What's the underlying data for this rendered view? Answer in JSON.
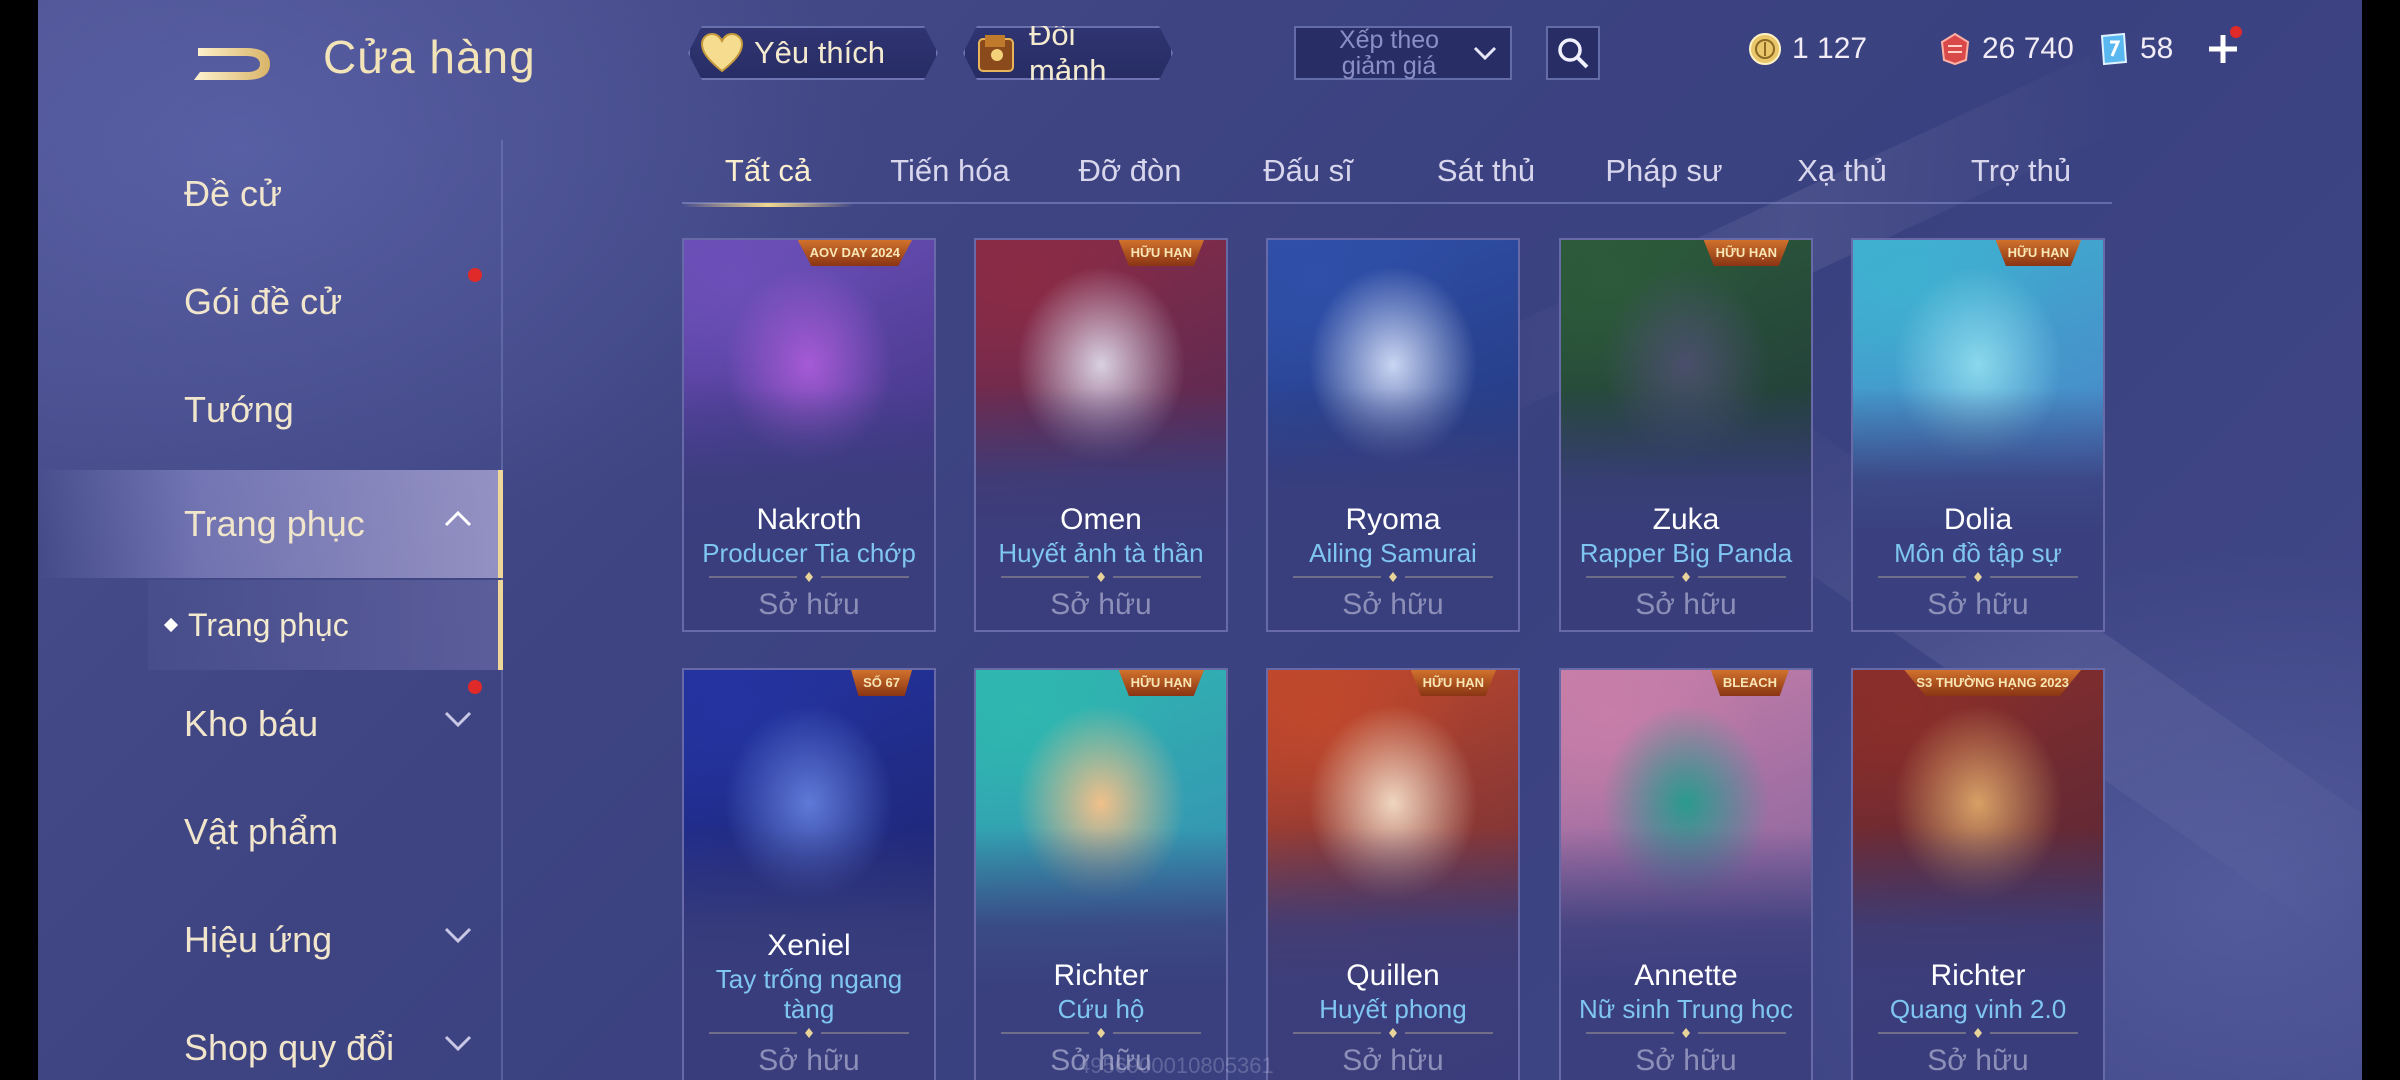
{
  "header": {
    "title": "Cửa hàng",
    "favorites_label": "Yêu thích",
    "exchange_label": "Đổi mảnh",
    "sort_label": "Xếp theo giảm giá",
    "currencies": [
      {
        "icon": "gold-coin-icon",
        "value": "1 127"
      },
      {
        "icon": "red-voucher-icon",
        "value": "26 740"
      },
      {
        "icon": "blue-coupon-icon",
        "value": "58"
      }
    ]
  },
  "sidebar": {
    "items": [
      {
        "label": "Đề cử"
      },
      {
        "label": "Gói đề cử",
        "badge": true
      },
      {
        "label": "Tướng"
      },
      {
        "label": "Trang phục",
        "expanded": true
      },
      {
        "label": "Kho báu",
        "badge": true,
        "collapsed": true
      },
      {
        "label": "Vật phẩm"
      },
      {
        "label": "Hiệu ứng",
        "collapsed": true
      },
      {
        "label": "Shop quy đổi",
        "collapsed": true
      }
    ],
    "sub_item": "Trang phục"
  },
  "tabs": [
    "Tất cả",
    "Tiến hóa",
    "Đỡ đòn",
    "Đấu sĩ",
    "Sát thủ",
    "Pháp sư",
    "Xạ thủ",
    "Trợ thủ"
  ],
  "active_tab": "Tất cả",
  "cards": [
    {
      "hero": "Nakroth",
      "skin": "Producer Tia chớp",
      "status": "Sở hữu",
      "tag": "AOV DAY 2024",
      "colors": [
        "#6c4fb8",
        "#a65ad6",
        "#2d2a6e"
      ]
    },
    {
      "hero": "Omen",
      "skin": "Huyết ảnh tà thần",
      "status": "Sở hữu",
      "tag": "HỮU HẠN",
      "colors": [
        "#8a2b46",
        "#d9d0e2",
        "#3b2a5c"
      ]
    },
    {
      "hero": "Ryoma",
      "skin": "Ailing Samurai",
      "status": "Sở hữu",
      "tag": "",
      "colors": [
        "#2f4fa8",
        "#c9d5f2",
        "#20306e"
      ]
    },
    {
      "hero": "Zuka",
      "skin": "Rapper Big Panda",
      "status": "Sở hữu",
      "tag": "HỮU HẠN",
      "colors": [
        "#2c5a3a",
        "#4a4f6c",
        "#1c2b3a"
      ]
    },
    {
      "hero": "Dolia",
      "skin": "Môn đồ tập sự",
      "status": "Sở hữu",
      "tag": "HỮU HẠN",
      "colors": [
        "#3fb0d0",
        "#8ad8ec",
        "#4e6fc4"
      ]
    },
    {
      "hero": "Xeniel",
      "skin": "Tay trống ngang tàng",
      "status": "Sở hữu",
      "tag": "SỐ 67",
      "colors": [
        "#2433a0",
        "#5f7ad8",
        "#1a1f5a"
      ]
    },
    {
      "hero": "Richter",
      "skin": "Cứu hộ",
      "status": "Sở hữu",
      "tag": "HỮU HẠN",
      "colors": [
        "#2fb7b0",
        "#f0c08a",
        "#3a7ab4"
      ]
    },
    {
      "hero": "Quillen",
      "skin": "Huyết phong",
      "status": "Sở hữu",
      "tag": "HỮU HẠN",
      "colors": [
        "#c0482c",
        "#f0d6c0",
        "#4a2440"
      ]
    },
    {
      "hero": "Annette",
      "skin": "Nữ sinh Trung học",
      "status": "Sở hữu",
      "tag": "BLEACH",
      "colors": [
        "#c77ea8",
        "#2a9a8e",
        "#6a5a9c"
      ]
    },
    {
      "hero": "Richter",
      "skin": "Quang vinh 2.0",
      "status": "Sở hữu",
      "tag": "S3 THƯỜNG HẠNG 2023",
      "colors": [
        "#8a2e2a",
        "#d8a066",
        "#3c2440"
      ]
    }
  ],
  "watermark": "4956900010805361"
}
